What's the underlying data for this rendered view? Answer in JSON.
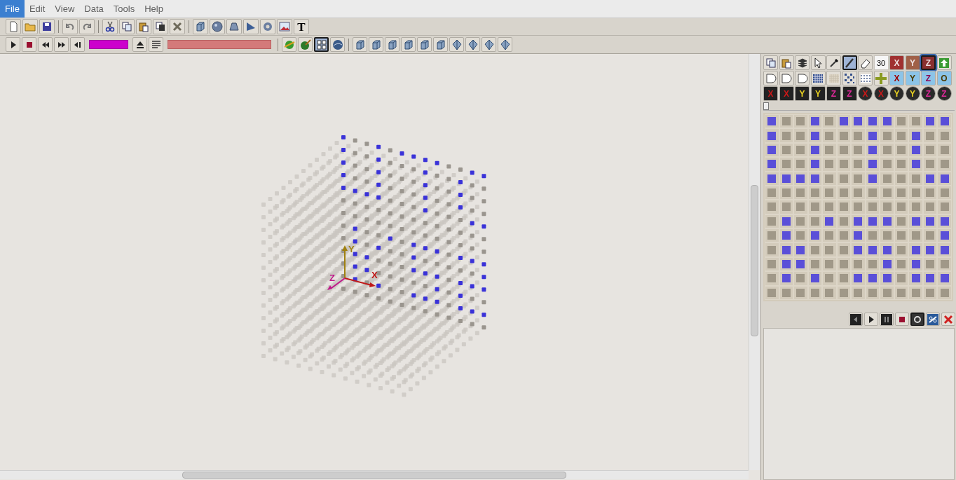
{
  "menu": [
    {
      "label": "File",
      "selected": true
    },
    {
      "label": "Edit",
      "selected": false
    },
    {
      "label": "View",
      "selected": false
    },
    {
      "label": "Data",
      "selected": false
    },
    {
      "label": "Tools",
      "selected": false
    },
    {
      "label": "Help",
      "selected": false
    }
  ],
  "toolbar_1": [
    {
      "kind": "new",
      "pressed": false
    },
    {
      "kind": "open",
      "pressed": false
    },
    {
      "kind": "save",
      "pressed": false
    },
    {
      "kind": "sep"
    },
    {
      "kind": "undo",
      "pressed": false
    },
    {
      "kind": "redo",
      "pressed": false
    },
    {
      "kind": "sep"
    },
    {
      "kind": "cut",
      "pressed": false
    },
    {
      "kind": "copy",
      "pressed": false
    },
    {
      "kind": "paste",
      "pressed": false
    },
    {
      "kind": "paste2",
      "pressed": false
    },
    {
      "kind": "delete",
      "pressed": false
    },
    {
      "kind": "sep"
    },
    {
      "kind": "cube",
      "pressed": false
    },
    {
      "kind": "sphere",
      "pressed": false
    },
    {
      "kind": "cone",
      "pressed": false
    },
    {
      "kind": "wedge",
      "pressed": false
    },
    {
      "kind": "torus",
      "pressed": false
    },
    {
      "kind": "image",
      "pressed": false
    },
    {
      "kind": "text",
      "label": "T",
      "pressed": false
    }
  ],
  "toolbar_2": [
    {
      "kind": "play",
      "pressed": false
    },
    {
      "kind": "stop",
      "pressed": false
    },
    {
      "kind": "rewind",
      "pressed": false
    },
    {
      "kind": "forward",
      "pressed": false
    },
    {
      "kind": "back",
      "pressed": false
    },
    {
      "kind": "swatch"
    },
    {
      "kind": "eject",
      "pressed": false
    },
    {
      "kind": "list",
      "pressed": false
    },
    {
      "kind": "bar"
    },
    {
      "kind": "sep"
    },
    {
      "kind": "planet",
      "pressed": false
    },
    {
      "kind": "brushball",
      "pressed": false
    },
    {
      "kind": "grid4",
      "pressed": true
    },
    {
      "kind": "ball",
      "pressed": false
    },
    {
      "kind": "sep"
    },
    {
      "kind": "view",
      "pressed": false
    },
    {
      "kind": "view",
      "pressed": false
    },
    {
      "kind": "view",
      "pressed": false
    },
    {
      "kind": "view",
      "pressed": false
    },
    {
      "kind": "view",
      "pressed": false
    },
    {
      "kind": "view",
      "pressed": false
    },
    {
      "kind": "viewd",
      "pressed": false
    },
    {
      "kind": "viewd",
      "pressed": false
    },
    {
      "kind": "viewd",
      "pressed": false
    },
    {
      "kind": "viewd",
      "pressed": false
    }
  ],
  "palette": [
    [
      {
        "kind": "copy",
        "pressed": false
      },
      {
        "kind": "paste",
        "pressed": false
      },
      {
        "kind": "layers",
        "pressed": false
      },
      {
        "kind": "pointer",
        "pressed": false
      },
      {
        "kind": "dropper",
        "pressed": false
      },
      {
        "kind": "brush",
        "pressed": true
      },
      {
        "kind": "eraser",
        "pressed": false
      },
      {
        "kind": "field",
        "value": "30"
      },
      {
        "kind": "letter",
        "label": "X",
        "pressed": false
      },
      {
        "kind": "letter",
        "label": "Y",
        "pressed": false
      },
      {
        "kind": "letter",
        "label": "Z",
        "pressed": true
      },
      {
        "kind": "up",
        "pressed": false
      }
    ],
    [
      {
        "kind": "layer",
        "pressed": false
      },
      {
        "kind": "layer",
        "pressed": false
      },
      {
        "kind": "layer",
        "pressed": false
      },
      {
        "kind": "gridfull",
        "pressed": false
      },
      {
        "kind": "gridempty",
        "pressed": false
      },
      {
        "kind": "gridcheck"
      },
      {
        "kind": "griddots",
        "pressed": false
      },
      {
        "kind": "plus",
        "pressed": false
      },
      {
        "kind": "mirror",
        "label": "X",
        "pressed": false
      },
      {
        "kind": "mirror",
        "label": "Y",
        "pressed": false
      },
      {
        "kind": "mirror",
        "label": "Z",
        "pressed": false
      },
      {
        "kind": "mirror",
        "label": "O",
        "pressed": false
      }
    ],
    [
      {
        "kind": "shift",
        "label": "X",
        "pressed": false
      },
      {
        "kind": "shift",
        "label": "X",
        "pressed": false
      },
      {
        "kind": "shift",
        "label": "Y",
        "pressed": false
      },
      {
        "kind": "shift",
        "label": "Y",
        "pressed": false
      },
      {
        "kind": "shift",
        "label": "Z",
        "pressed": false
      },
      {
        "kind": "shift",
        "label": "Z",
        "pressed": false
      },
      {
        "kind": "rotate",
        "label": "X",
        "pressed": false
      },
      {
        "kind": "rotate",
        "label": "X",
        "pressed": false
      },
      {
        "kind": "rotate",
        "label": "Y",
        "pressed": false
      },
      {
        "kind": "rotate",
        "label": "Y",
        "pressed": false
      },
      {
        "kind": "rotate",
        "label": "Z",
        "pressed": false
      },
      {
        "kind": "rotate",
        "label": "Z",
        "pressed": false
      }
    ]
  ],
  "layer_slider": {
    "level": 0
  },
  "grid": {
    "rows": [
      [
        true,
        false,
        false,
        true,
        false,
        true,
        true,
        true,
        true,
        false,
        false,
        true,
        true
      ],
      [
        true,
        false,
        false,
        true,
        false,
        false,
        false,
        true,
        false,
        false,
        true,
        false,
        false
      ],
      [
        true,
        false,
        false,
        true,
        false,
        false,
        false,
        true,
        false,
        false,
        true,
        false,
        false
      ],
      [
        true,
        false,
        false,
        true,
        false,
        false,
        false,
        true,
        false,
        false,
        true,
        false,
        false
      ],
      [
        true,
        true,
        true,
        true,
        false,
        false,
        false,
        true,
        false,
        false,
        false,
        true,
        true
      ],
      [
        false,
        false,
        false,
        false,
        false,
        false,
        false,
        false,
        false,
        false,
        false,
        false,
        false
      ],
      [
        false,
        false,
        false,
        false,
        false,
        false,
        false,
        false,
        false,
        false,
        false,
        false,
        false
      ],
      [
        false,
        true,
        false,
        false,
        true,
        false,
        true,
        true,
        true,
        false,
        true,
        true,
        true
      ],
      [
        false,
        true,
        false,
        true,
        false,
        false,
        true,
        false,
        false,
        false,
        false,
        false,
        true
      ],
      [
        false,
        true,
        true,
        false,
        false,
        false,
        true,
        true,
        true,
        false,
        true,
        true,
        true
      ],
      [
        false,
        true,
        true,
        false,
        false,
        false,
        false,
        false,
        true,
        false,
        true,
        false,
        false
      ],
      [
        false,
        true,
        false,
        true,
        false,
        false,
        true,
        true,
        true,
        false,
        true,
        true,
        true
      ],
      [
        false,
        false,
        false,
        false,
        false,
        false,
        false,
        false,
        false,
        false,
        false,
        false,
        false
      ]
    ]
  },
  "player": [
    {
      "kind": "prev",
      "pressed": false
    },
    {
      "kind": "play",
      "pressed": false
    },
    {
      "kind": "pause",
      "pressed": false
    },
    {
      "kind": "stop",
      "pressed": false
    },
    {
      "kind": "loop",
      "pressed": true
    },
    {
      "kind": "link",
      "pressed": false
    },
    {
      "kind": "close",
      "pressed": false
    }
  ],
  "axes": [
    {
      "label": "Y"
    },
    {
      "label": "X"
    },
    {
      "label": "Z"
    }
  ]
}
